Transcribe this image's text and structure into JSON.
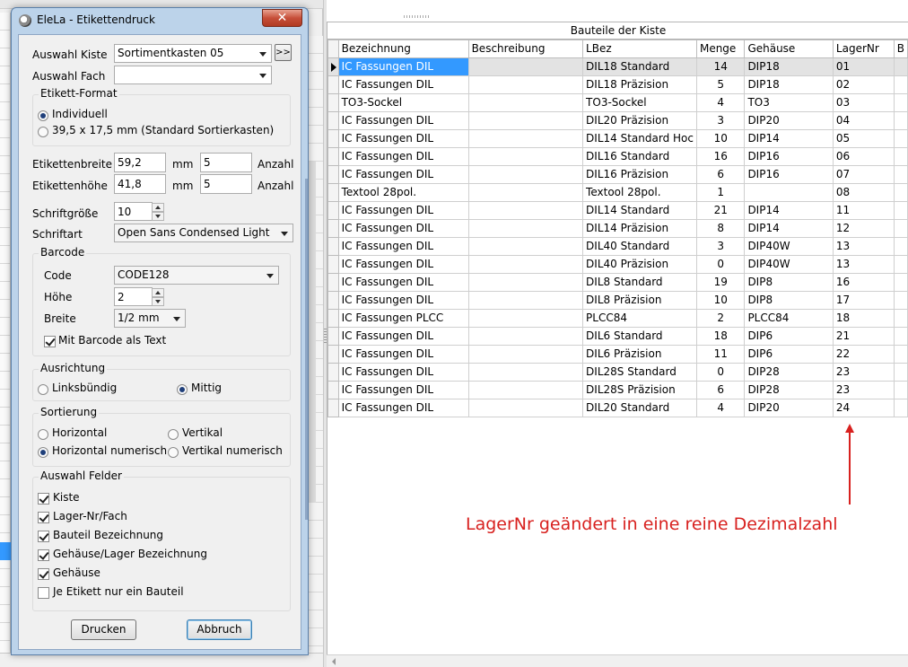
{
  "dialog": {
    "title": "EleLa - Etikettendruck",
    "close_symbol": "✕",
    "auswahl_kiste_label": "Auswahl Kiste",
    "auswahl_kiste_value": "Sortimentkasten 05",
    "nav_button_label": ">>",
    "auswahl_fach_label": "Auswahl Fach",
    "auswahl_fach_value": "",
    "format": {
      "title": "Etikett-Format",
      "individuell": "Individuell",
      "standard": "39,5 x 17,5 mm (Standard Sortierkasten)"
    },
    "breite_label": "Etikettenbreite",
    "breite_value": "59,2",
    "breite_unit": "mm",
    "breite_anzahl": "5",
    "hoehe_label": "Etikettenhöhe",
    "hoehe_value": "41,8",
    "hoehe_unit": "mm",
    "hoehe_anzahl": "5",
    "anzahl_label": "Anzahl",
    "schriftgroesse_label": "Schriftgröße",
    "schriftgroesse_value": "10",
    "schriftart_label": "Schriftart",
    "schriftart_value": "Open Sans Condensed Light",
    "barcode": {
      "title": "Barcode",
      "code_label": "Code",
      "code_value": "CODE128",
      "hoehe_label": "Höhe",
      "hoehe_value": "2",
      "breite_label": "Breite",
      "breite_value": "1/2 mm",
      "mit_text_label": "Mit Barcode als Text"
    },
    "ausrichtung": {
      "title": "Ausrichtung",
      "links": "Linksbündig",
      "mittig": "Mittig"
    },
    "sortierung": {
      "title": "Sortierung",
      "horizontal": "Horizontal",
      "vertikal": "Vertikal",
      "horizontal_numerisch": "Horizontal numerisch",
      "vertikal_numerisch": "Vertikal numerisch"
    },
    "felder": {
      "title": "Auswahl Felder",
      "items": [
        {
          "label": "Kiste",
          "checked": true
        },
        {
          "label": "Lager-Nr/Fach",
          "checked": true
        },
        {
          "label": "Bauteil Bezeichnung",
          "checked": true
        },
        {
          "label": "Gehäuse/Lager Bezeichnung",
          "checked": true
        },
        {
          "label": "Gehäuse",
          "checked": true
        },
        {
          "label": "Je Etikett nur ein Bauteil",
          "checked": false
        }
      ]
    },
    "drucken_label": "Drucken",
    "abbruch_label": "Abbruch"
  },
  "grid": {
    "caption": "Bauteile der Kiste",
    "columns": [
      "Bezeichnung",
      "Beschreibung",
      "LBez",
      "Menge",
      "Gehäuse",
      "LagerNr",
      "B"
    ],
    "rows": [
      [
        "IC Fassungen DIL",
        "",
        "DIL18 Standard",
        "14",
        "DIP18",
        "01"
      ],
      [
        "IC Fassungen DIL",
        "",
        "DIL18 Präzision",
        "5",
        "DIP18",
        "02"
      ],
      [
        "TO3-Sockel",
        "",
        "TO3-Sockel",
        "4",
        "TO3",
        "03"
      ],
      [
        "IC Fassungen DIL",
        "",
        "DIL20 Präzision",
        "3",
        "DIP20",
        "04"
      ],
      [
        "IC Fassungen DIL",
        "",
        "DIL14 Standard Hoc",
        "10",
        "DIP14",
        "05"
      ],
      [
        "IC Fassungen DIL",
        "",
        "DIL16 Standard",
        "16",
        "DIP16",
        "06"
      ],
      [
        "IC Fassungen DIL",
        "",
        "DIL16 Präzision",
        "6",
        "DIP16",
        "07"
      ],
      [
        "Textool 28pol.",
        "",
        "Textool 28pol.",
        "1",
        "",
        "08"
      ],
      [
        "IC Fassungen DIL",
        "",
        "DIL14 Standard",
        "21",
        "DIP14",
        "11"
      ],
      [
        "IC Fassungen DIL",
        "",
        "DIL14 Präzision",
        "8",
        "DIP14",
        "12"
      ],
      [
        "IC Fassungen DIL",
        "",
        "DIL40 Standard",
        "3",
        "DIP40W",
        "13"
      ],
      [
        "IC Fassungen DIL",
        "",
        "DIL40 Präzision",
        "0",
        "DIP40W",
        "13"
      ],
      [
        "IC Fassungen DIL",
        "",
        "DIL8 Standard",
        "19",
        "DIP8",
        "16"
      ],
      [
        "IC Fassungen DIL",
        "",
        "DIL8 Präzision",
        "10",
        "DIP8",
        "17"
      ],
      [
        "IC Fassungen PLCC",
        "",
        "PLCC84",
        "2",
        "PLCC84",
        "18"
      ],
      [
        "IC Fassungen DIL",
        "",
        "DIL6 Standard",
        "18",
        "DIP6",
        "21"
      ],
      [
        "IC Fassungen DIL",
        "",
        "DIL6 Präzision",
        "11",
        "DIP6",
        "22"
      ],
      [
        "IC Fassungen DIL",
        "",
        "DIL28S Standard",
        "0",
        "DIP28",
        "23"
      ],
      [
        "IC Fassungen DIL",
        "",
        "DIL28S Präzision",
        "6",
        "DIP28",
        "23"
      ],
      [
        "IC Fassungen DIL",
        "",
        "DIL20 Standard",
        "4",
        "DIP20",
        "24"
      ]
    ]
  },
  "annotation": {
    "text": "LagerNr geändert in eine reine Dezimalzahl",
    "color": "#d8211f"
  },
  "colors": {
    "selection": "#3399ff",
    "window_frame": "#bcd3ea"
  }
}
